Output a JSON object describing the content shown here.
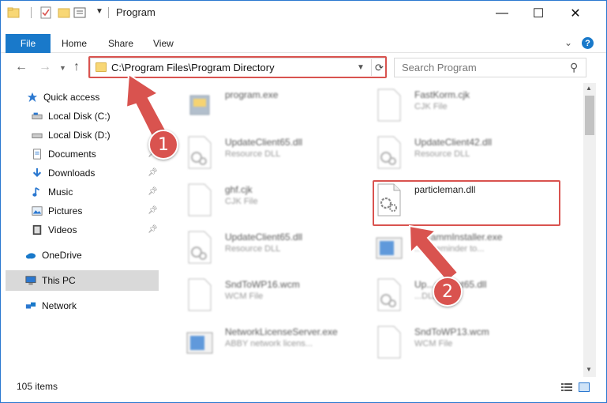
{
  "window": {
    "title": "Program",
    "controls": {
      "minimize": "—",
      "maximize": "☐",
      "close": "✕"
    }
  },
  "ribbon": {
    "tabs": [
      "File",
      "Home",
      "Share",
      "View"
    ],
    "help": "?"
  },
  "navbar": {
    "address": "C:\\Program Files\\Program Directory",
    "search_placeholder": "Search Program"
  },
  "sidebar": {
    "items": [
      {
        "label": "Quick access",
        "icon": "star-icon"
      },
      {
        "label": "Local Disk (C:)",
        "icon": "drive-icon"
      },
      {
        "label": "Local Disk (D:)",
        "icon": "drive-icon"
      },
      {
        "label": "Documents",
        "icon": "documents-icon"
      },
      {
        "label": "Downloads",
        "icon": "download-icon"
      },
      {
        "label": "Music",
        "icon": "music-icon"
      },
      {
        "label": "Pictures",
        "icon": "pictures-icon"
      },
      {
        "label": "Videos",
        "icon": "videos-icon"
      },
      {
        "label": "OneDrive",
        "icon": "cloud-icon"
      },
      {
        "label": "This PC",
        "icon": "computer-icon"
      },
      {
        "label": "Network",
        "icon": "network-icon"
      }
    ]
  },
  "files": {
    "left": [
      {
        "name": "program.exe",
        "type": ""
      },
      {
        "name": "UpdateClient65.dll",
        "type": "Resource DLL"
      },
      {
        "name": "ghf.cjk",
        "type": "CJK File"
      },
      {
        "name": "UpdateClient65.dll",
        "type": "Resource DLL"
      },
      {
        "name": "SndToWP16.wcm",
        "type": "WCM File"
      },
      {
        "name": "NetworkLicenseServer.exe",
        "type": "ABBY network licens..."
      }
    ],
    "right": [
      {
        "name": "FastKorm.cjk",
        "type": "CJK File"
      },
      {
        "name": "UpdateClient42.dll",
        "type": "Resource DLL"
      },
      {
        "name": "particleman.dll",
        "type": ""
      },
      {
        "name": "...grammInstaller.exe",
        "type": "...Y Reminder to..."
      },
      {
        "name": "Up...eClient65.dll",
        "type": "...DLL"
      },
      {
        "name": "SndToWP13.wcm",
        "type": "WCM File"
      }
    ]
  },
  "status": {
    "item_count": "105 items"
  },
  "callouts": {
    "one": "1",
    "two": "2"
  },
  "colors": {
    "accent": "#1979ca",
    "highlight": "#d9534f",
    "folder": "#f8d775"
  }
}
